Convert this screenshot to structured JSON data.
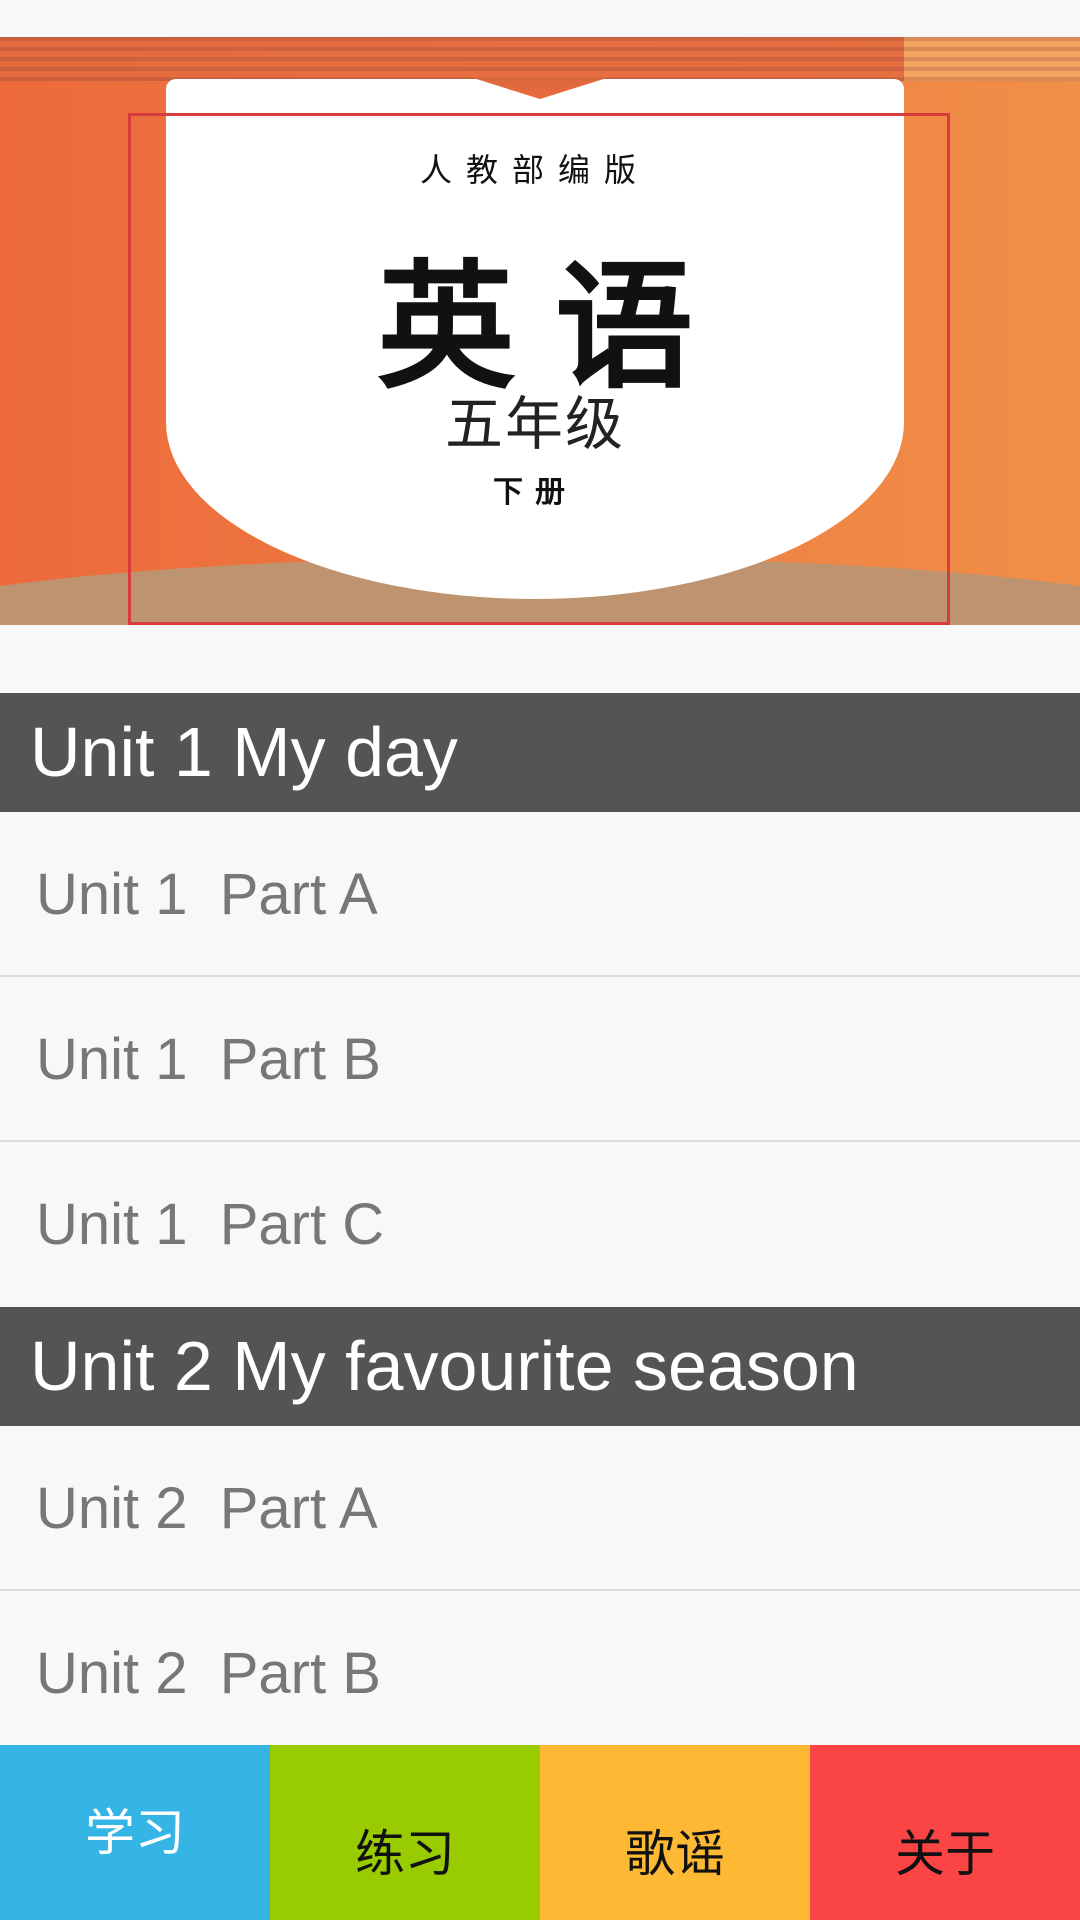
{
  "cover": {
    "publisher": "人教部编版",
    "subject": "英语",
    "grade": "五年级",
    "volume": "下册",
    "colors": {
      "background": "#ec6a3c",
      "page": "#ffffff",
      "frame": "#d83b3b",
      "ground": "#be9470"
    }
  },
  "units": [
    {
      "title": "Unit 1 My day",
      "lessons": [
        "Unit 1  Part A",
        "Unit 1  Part B",
        "Unit 1  Part C"
      ]
    },
    {
      "title": "Unit 2 My favourite season",
      "lessons": [
        "Unit 2  Part A",
        "Unit 2  Part B"
      ]
    }
  ],
  "bottom_nav": {
    "tabs": [
      {
        "label": "学习",
        "color": "#35b5e6",
        "active": true
      },
      {
        "label": "练习",
        "color": "#99cc00",
        "active": false
      },
      {
        "label": "歌谣",
        "color": "#fdb933",
        "active": false
      },
      {
        "label": "关于",
        "color": "#fb4545",
        "active": false
      }
    ]
  }
}
